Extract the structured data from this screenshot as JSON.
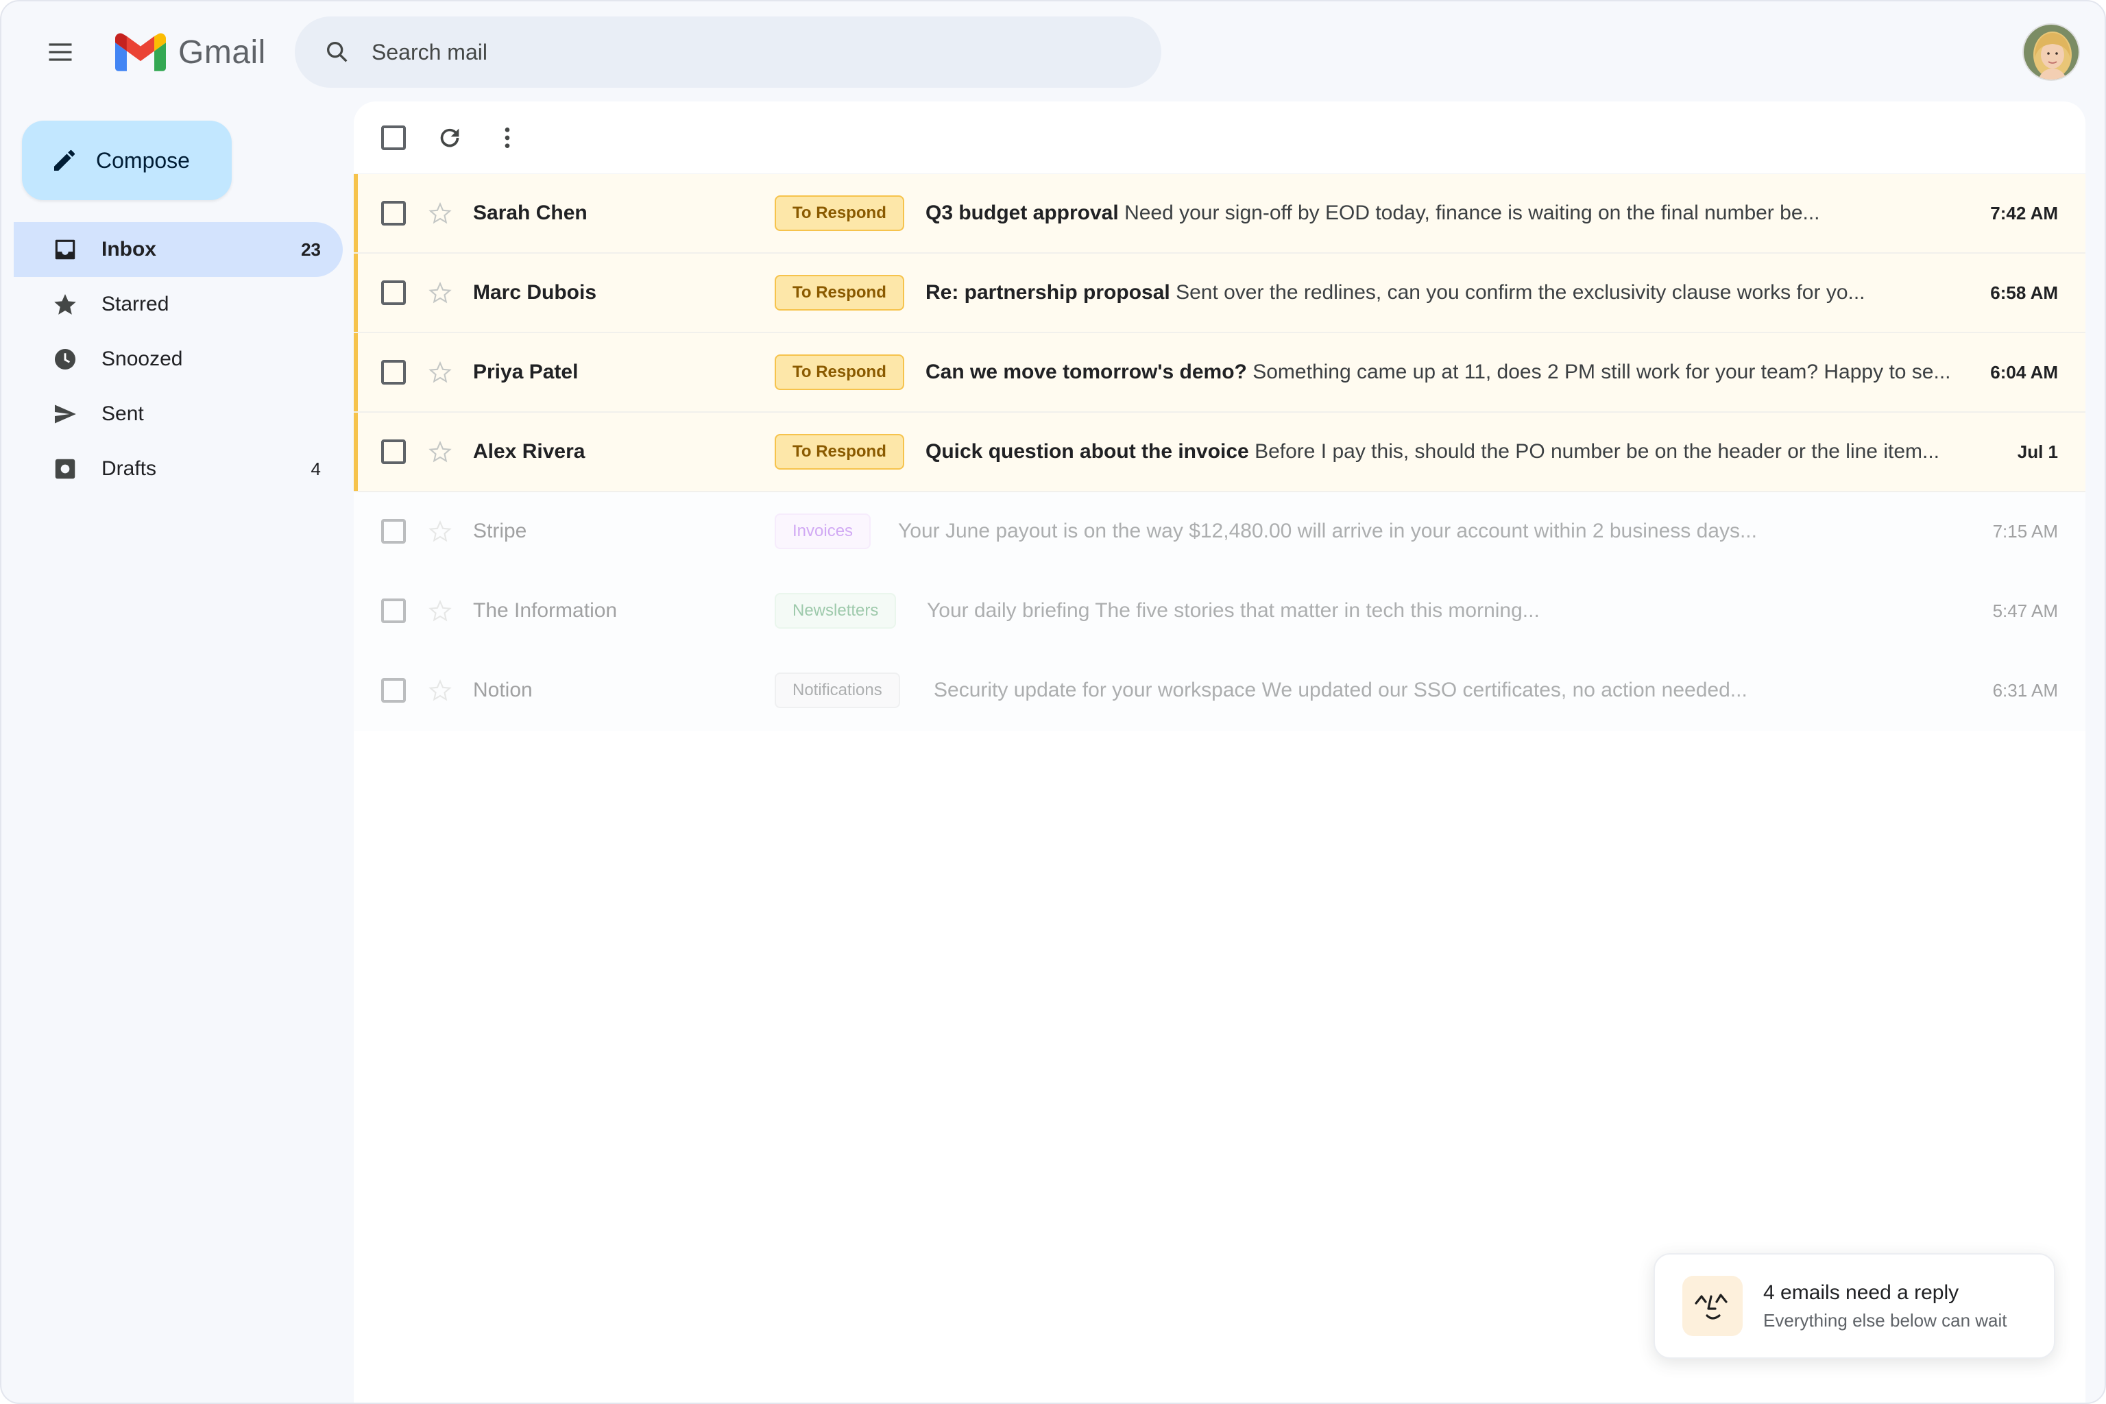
{
  "app": {
    "name": "Gmail"
  },
  "search": {
    "placeholder": "Search mail"
  },
  "compose": {
    "label": "Compose"
  },
  "sidebar": {
    "items": [
      {
        "label": "Inbox",
        "count": "23",
        "icon": "inbox-icon",
        "active": true
      },
      {
        "label": "Starred",
        "count": "",
        "icon": "star-icon"
      },
      {
        "label": "Snoozed",
        "count": "",
        "icon": "clock-icon"
      },
      {
        "label": "Sent",
        "count": "",
        "icon": "send-icon"
      },
      {
        "label": "Drafts",
        "count": "4",
        "icon": "draft-icon"
      }
    ]
  },
  "emails": [
    {
      "sender": "Sarah Chen",
      "label": "To Respond",
      "subject": "Q3 budget approval",
      "snippet": "Need your sign-off by EOD today, finance is waiting on the final number be...",
      "time": "7:42 AM"
    },
    {
      "sender": "Marc Dubois",
      "label": "To Respond",
      "subject": "Re: partnership proposal",
      "snippet": "Sent over the redlines, can you confirm the exclusivity clause works for yo...",
      "time": "6:58 AM"
    },
    {
      "sender": "Priya Patel",
      "label": "To Respond",
      "subject": "Can we move tomorrow's demo?",
      "snippet": "Something came up at 11, does 2 PM still work for your team? Happy to se...",
      "time": "6:04 AM"
    },
    {
      "sender": "Alex Rivera",
      "label": "To Respond",
      "subject": "Quick question about the invoice",
      "snippet": "Before I pay this, should the PO number be on the header or the line item...",
      "time": "Jul 1"
    },
    {
      "sender": "Stripe",
      "label": "Invoices",
      "subject": "Your June payout is on the way",
      "snippet": "$12,480.00 will arrive in your account within 2 business days...",
      "time": "7:15 AM"
    },
    {
      "sender": "The Information",
      "label": "Newsletters",
      "subject": "Your daily briefing",
      "snippet": "The five stories that matter in tech this morning...",
      "time": "5:47 AM"
    },
    {
      "sender": "Notion",
      "label": "Notifications",
      "subject": "Security update for your workspace",
      "snippet": "We updated our SSO certificates, no action needed...",
      "time": "6:31 AM"
    }
  ],
  "toast": {
    "title": "4 emails need a reply",
    "subtitle": "Everything else below can wait"
  },
  "colors": {
    "accent": "#c2e7ff",
    "active_nav": "#d3e3fd",
    "respond_label": "#fde7a9",
    "urgent_bar": "#f6c34c"
  }
}
